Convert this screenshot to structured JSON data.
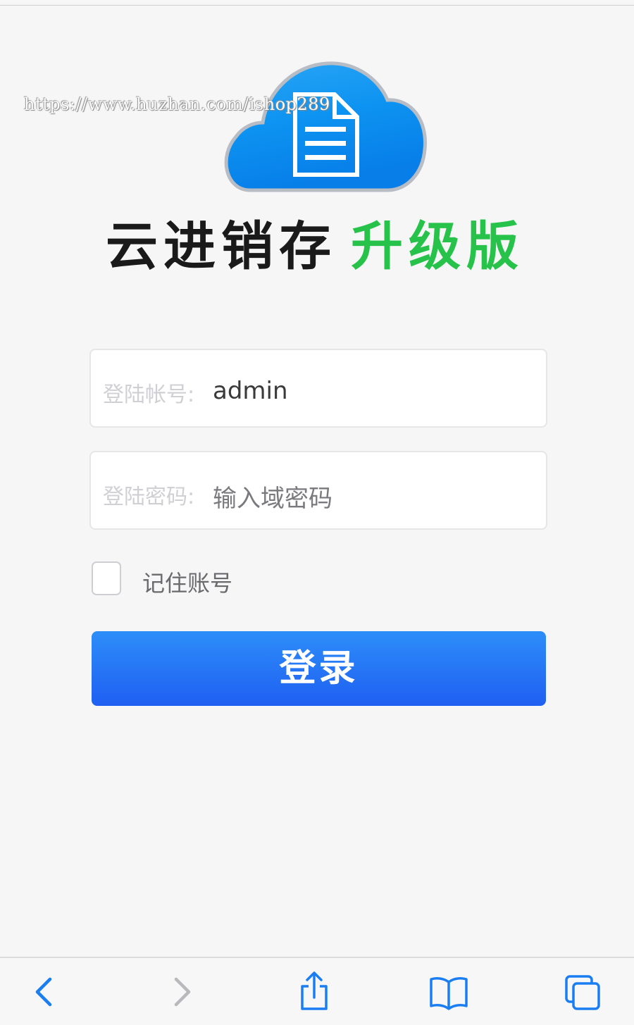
{
  "watermark": "https://www.huzhan.com/ishop289",
  "brand": {
    "name": "云进销存",
    "edition": "升级版"
  },
  "login_form": {
    "account_label": "登陆帐号:",
    "account_value": "admin",
    "password_label": "登陆密码:",
    "password_placeholder": "输入域密码",
    "remember_label": "记住账号",
    "remember_checked": false,
    "submit_label": "登录"
  },
  "colors": {
    "brand_green": "#27c24a",
    "button_blue": "#2475f5",
    "icon_blue": "#1a7ef2"
  },
  "browser_toolbar": {
    "icons": [
      "back-icon",
      "forward-icon",
      "share-icon",
      "bookmarks-icon",
      "tabs-icon"
    ]
  }
}
